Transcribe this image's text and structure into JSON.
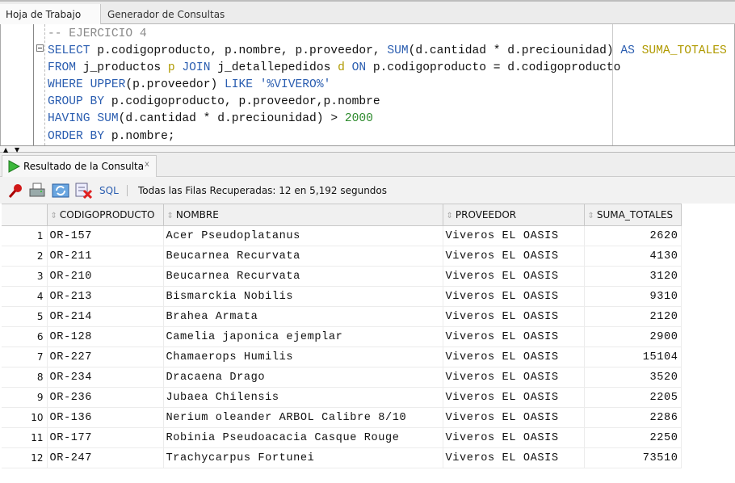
{
  "tabs": [
    {
      "label": "Hoja de Trabajo"
    },
    {
      "label": "Generador de Consultas"
    }
  ],
  "editor": {
    "lines": [
      [
        {
          "t": "-- EJERCICIO 4",
          "c": "cm"
        }
      ],
      [
        {
          "t": "SELECT",
          "c": "kw"
        },
        {
          "t": " p.codigoproducto, p.nombre, p.proveedor, ",
          "c": "id"
        },
        {
          "t": "SUM",
          "c": "kw"
        },
        {
          "t": "(d.cantidad * d.preciounidad) ",
          "c": "id"
        },
        {
          "t": "AS",
          "c": "kw"
        },
        {
          "t": " SUMA_TOTALES",
          "c": "al"
        }
      ],
      [
        {
          "t": "FROM",
          "c": "kw"
        },
        {
          "t": " j_productos ",
          "c": "id"
        },
        {
          "t": "p",
          "c": "al"
        },
        {
          "t": " ",
          "c": "id"
        },
        {
          "t": "JOIN",
          "c": "kw"
        },
        {
          "t": " j_detallepedidos ",
          "c": "id"
        },
        {
          "t": "d",
          "c": "al"
        },
        {
          "t": " ",
          "c": "id"
        },
        {
          "t": "ON",
          "c": "kw"
        },
        {
          "t": " p.codigoproducto = d.codigoproducto",
          "c": "id"
        }
      ],
      [
        {
          "t": "WHERE",
          "c": "kw"
        },
        {
          "t": " ",
          "c": "id"
        },
        {
          "t": "UPPER",
          "c": "kw"
        },
        {
          "t": "(p.proveedor) ",
          "c": "id"
        },
        {
          "t": "LIKE",
          "c": "kw"
        },
        {
          "t": " '%VIVERO%'",
          "c": "str"
        }
      ],
      [
        {
          "t": "GROUP BY",
          "c": "kw"
        },
        {
          "t": " p.codigoproducto, p.proveedor,p.nombre",
          "c": "id"
        }
      ],
      [
        {
          "t": "HAVING",
          "c": "kw"
        },
        {
          "t": " ",
          "c": "id"
        },
        {
          "t": "SUM",
          "c": "kw"
        },
        {
          "t": "(d.cantidad * d.preciounidad) > ",
          "c": "id"
        },
        {
          "t": "2000",
          "c": "num"
        }
      ],
      [
        {
          "t": "ORDER BY",
          "c": "kw"
        },
        {
          "t": " p.nombre;",
          "c": "id"
        }
      ]
    ]
  },
  "results": {
    "tab_label": "Resultado de la Consulta",
    "close_label": "x",
    "toolbar": {
      "sql_label": "SQL",
      "status": "Todas las Filas Recuperadas: 12 en 5,192 segundos",
      "icons": [
        "pin-icon",
        "print-icon",
        "refresh-icon",
        "delete-icon"
      ]
    },
    "columns": [
      "CODIGOPRODUCTO",
      "NOMBRE",
      "PROVEEDOR",
      "SUMA_TOTALES"
    ],
    "rows": [
      [
        "1",
        "OR-157",
        "Acer Pseudoplatanus",
        "Viveros EL OASIS",
        "2620"
      ],
      [
        "2",
        "OR-211",
        "Beucarnea Recurvata",
        "Viveros EL OASIS",
        "4130"
      ],
      [
        "3",
        "OR-210",
        "Beucarnea Recurvata",
        "Viveros EL OASIS",
        "3120"
      ],
      [
        "4",
        "OR-213",
        "Bismarckia Nobilis",
        "Viveros EL OASIS",
        "9310"
      ],
      [
        "5",
        "OR-214",
        "Brahea Armata",
        "Viveros EL OASIS",
        "2120"
      ],
      [
        "6",
        "OR-128",
        "Camelia japonica ejemplar",
        "Viveros EL OASIS",
        "2900"
      ],
      [
        "7",
        "OR-227",
        "Chamaerops Humilis",
        "Viveros EL OASIS",
        "15104"
      ],
      [
        "8",
        "OR-234",
        "Dracaena Drago",
        "Viveros EL OASIS",
        "3520"
      ],
      [
        "9",
        "OR-236",
        "Jubaea Chilensis",
        "Viveros EL OASIS",
        "2205"
      ],
      [
        "10",
        "OR-136",
        "Nerium oleander ARBOL Calibre 8/10",
        "Viveros EL OASIS",
        "2286"
      ],
      [
        "11",
        "OR-177",
        "Robinia Pseudoacacia Casque Rouge",
        "Viveros EL OASIS",
        "2250"
      ],
      [
        "12",
        "OR-247",
        "Trachycarpus Fortunei",
        "Viveros EL OASIS",
        "73510"
      ]
    ]
  }
}
